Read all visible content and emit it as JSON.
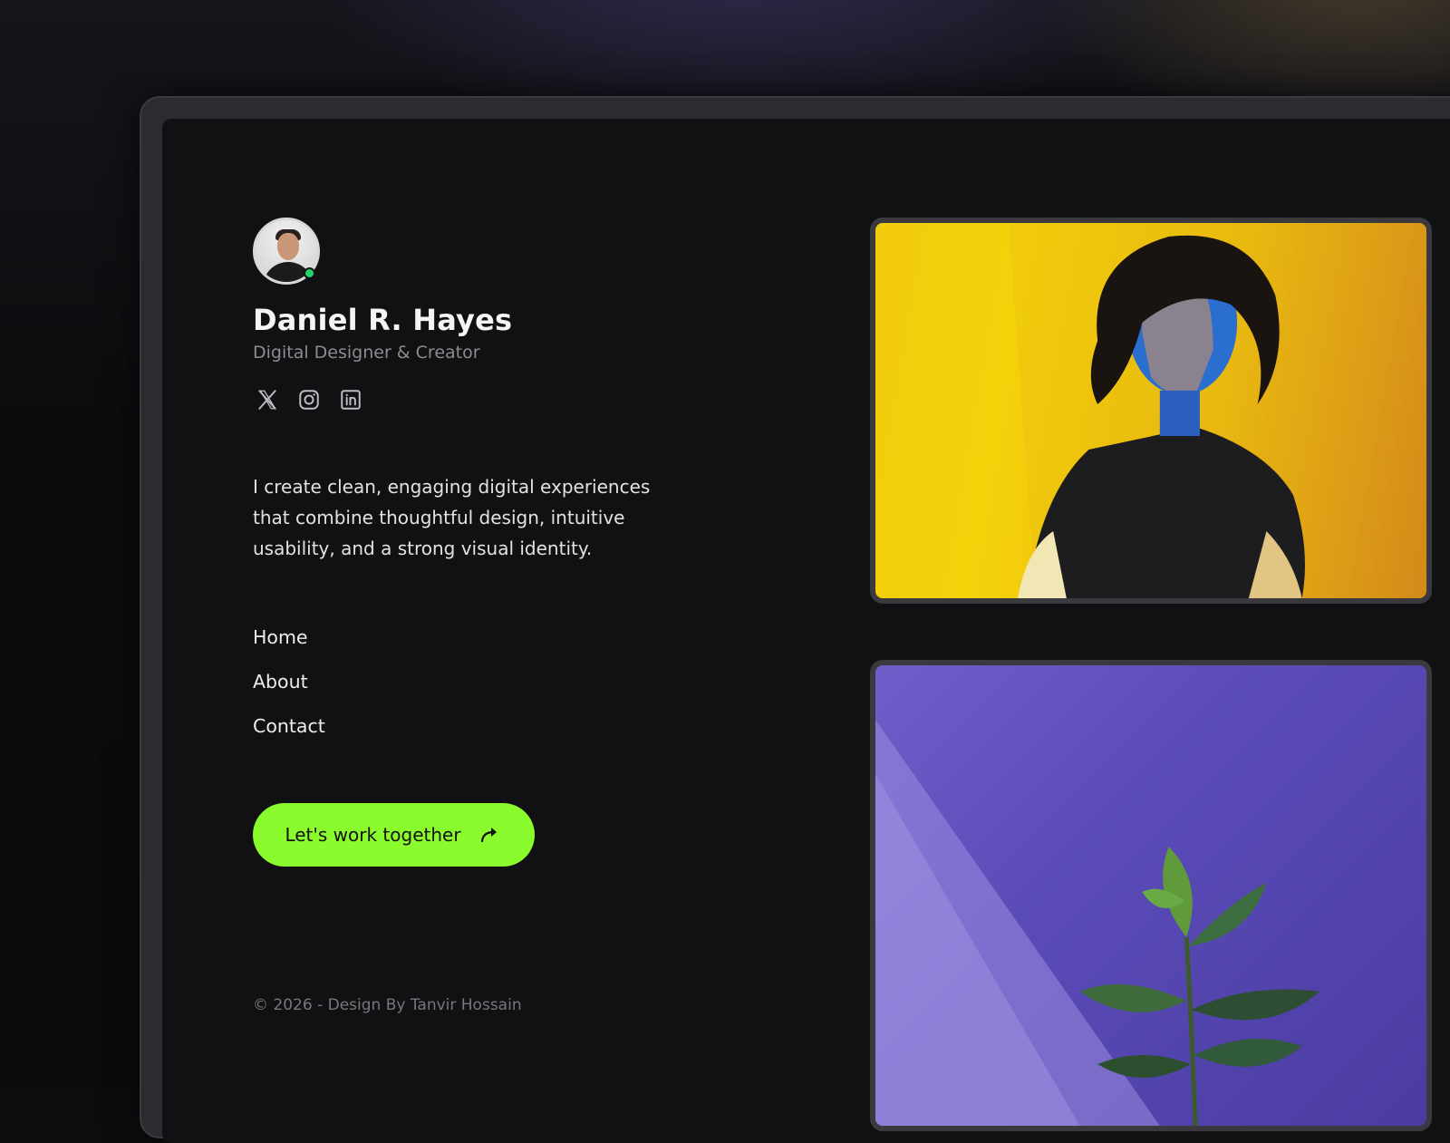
{
  "profile": {
    "name": "Daniel R. Hayes",
    "role": "Digital Designer & Creator",
    "status": "online",
    "status_color": "#22d36a"
  },
  "socials": [
    {
      "icon": "x-icon",
      "label": "X"
    },
    {
      "icon": "instagram-icon",
      "label": "Instagram"
    },
    {
      "icon": "linkedin-icon",
      "label": "LinkedIn"
    }
  ],
  "bio": "I create clean, engaging digital experiences that combine thoughtful design, intuitive usability, and a strong visual identity.",
  "nav": {
    "items": [
      "Home",
      "About",
      "Contact"
    ]
  },
  "cta": {
    "label": "Let's work together",
    "icon": "share-arrow-icon",
    "color": "#8afc2d"
  },
  "footer": {
    "text": "© 2026 - Design By Tanvir Hossain"
  },
  "gallery": [
    {
      "subject": "portrait",
      "accent": "#f0c80e"
    },
    {
      "subject": "plant",
      "accent": "#5a4bb8"
    }
  ]
}
